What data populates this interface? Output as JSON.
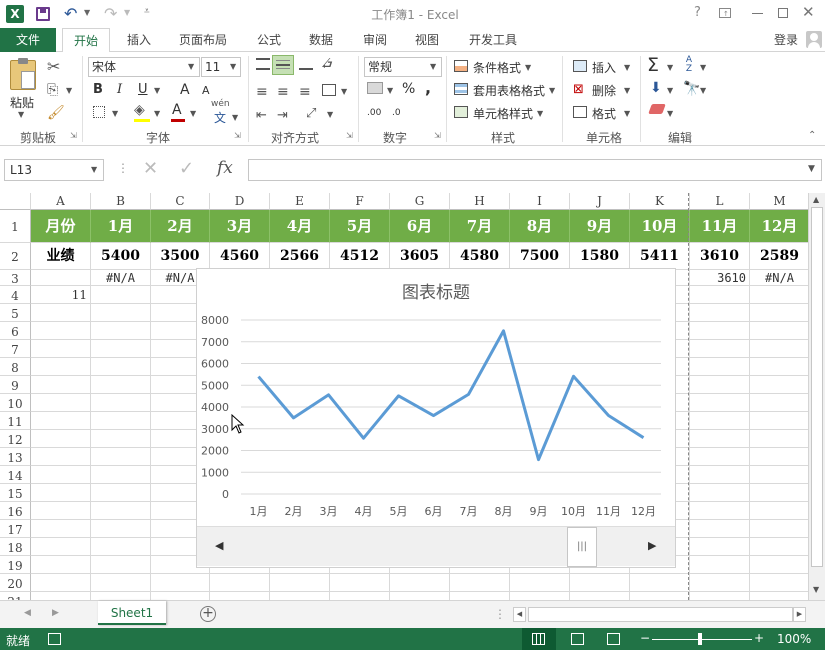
{
  "window": {
    "title": "工作簿1 - Excel",
    "excel_logo": "X",
    "help": "?",
    "login": "登录"
  },
  "tabs": [
    {
      "label": "文件",
      "active": false,
      "file": true
    },
    {
      "label": "开始",
      "active": true
    },
    {
      "label": "插入"
    },
    {
      "label": "页面布局"
    },
    {
      "label": "公式"
    },
    {
      "label": "数据"
    },
    {
      "label": "审阅"
    },
    {
      "label": "视图"
    },
    {
      "label": "开发工具"
    }
  ],
  "ribbon": {
    "clipboard": {
      "label": "剪贴板",
      "paste": "粘贴"
    },
    "font": {
      "label": "字体",
      "name": "宋体",
      "size": "11",
      "bold": "B",
      "italic": "I",
      "underline": "U",
      "grow": "A",
      "shrink": "A",
      "color_a": "A",
      "wen": "wén",
      "wen_char": "文"
    },
    "align": {
      "label": "对齐方式"
    },
    "number": {
      "label": "数字",
      "format": "常规",
      "percent": "%",
      "comma": ",",
      "dec_inc": ".00",
      "dec_dec": ".0"
    },
    "styles": {
      "label": "样式",
      "cond": "条件格式",
      "table": "套用表格格式",
      "cell": "单元格样式"
    },
    "cells": {
      "label": "单元格",
      "insert": "插入",
      "delete": "删除",
      "format": "格式"
    },
    "editing": {
      "label": "编辑",
      "sigma": "Σ",
      "sort": "A Z"
    }
  },
  "formula_bar": {
    "name_box": "L13",
    "fx": "fx",
    "value": ""
  },
  "columns": [
    "A",
    "B",
    "C",
    "D",
    "E",
    "F",
    "G",
    "H",
    "I",
    "J",
    "K",
    "L",
    "M"
  ],
  "rows": [
    "1",
    "2",
    "3",
    "4",
    "5",
    "6",
    "7",
    "8",
    "9",
    "10",
    "11",
    "12",
    "13",
    "14",
    "15",
    "16",
    "17",
    "18",
    "19",
    "20",
    "21"
  ],
  "row1": [
    "月份",
    "1月",
    "2月",
    "3月",
    "4月",
    "5月",
    "6月",
    "7月",
    "8月",
    "9月",
    "10月",
    "11月",
    "12月"
  ],
  "row2": [
    "业绩",
    "5400",
    "3500",
    "4560",
    "2566",
    "4512",
    "3605",
    "4580",
    "7500",
    "1580",
    "5411",
    "3610",
    "2589"
  ],
  "row3": {
    "B": "#N/A",
    "C": "#N/A",
    "L": "3610",
    "M": "#N/A"
  },
  "row4": {
    "A": "11"
  },
  "colors": {
    "header_green": "#70ad47",
    "excel_green": "#217346",
    "line_blue": "#5b9bd5"
  },
  "chart_data": {
    "type": "line",
    "title": "图表标题",
    "categories": [
      "1月",
      "2月",
      "3月",
      "4月",
      "5月",
      "6月",
      "7月",
      "8月",
      "9月",
      "10月",
      "11月",
      "12月"
    ],
    "series": [
      {
        "values": [
          5400,
          3500,
          4560,
          2566,
          4512,
          3605,
          4580,
          7500,
          1580,
          5411,
          3610,
          2589
        ]
      }
    ],
    "ylim": [
      0,
      8000
    ],
    "yticks": [
      "0",
      "1000",
      "2000",
      "3000",
      "4000",
      "5000",
      "6000",
      "7000",
      "8000"
    ],
    "grid": true
  },
  "sheet_tabs": [
    "Sheet1"
  ],
  "status": {
    "ready": "就绪",
    "zoom": "100%",
    "minus": "−",
    "plus": "+"
  }
}
